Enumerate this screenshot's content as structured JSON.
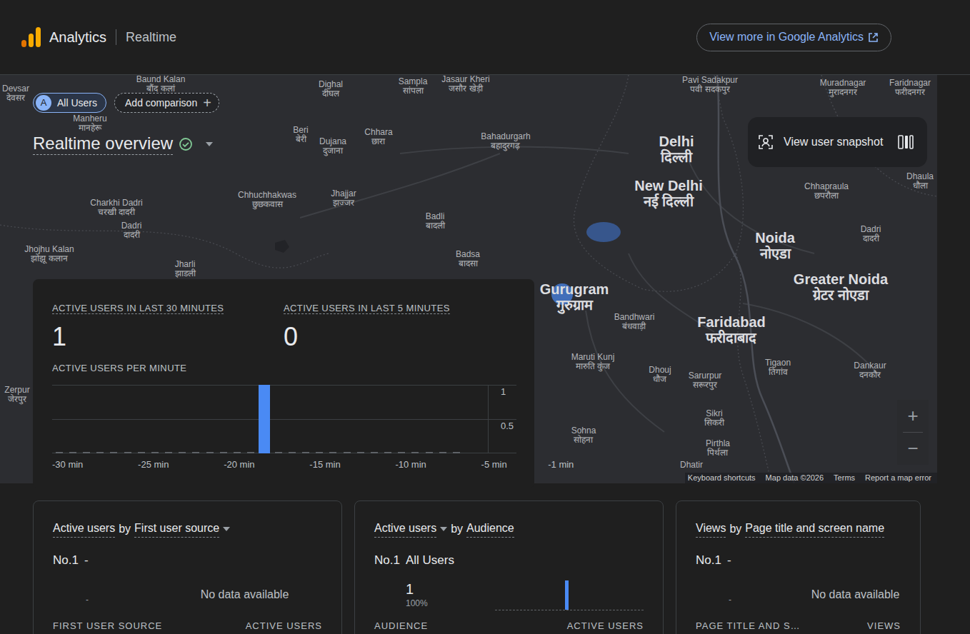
{
  "header": {
    "product": "Analytics",
    "page": "Realtime",
    "link_button": "View more in Google Analytics"
  },
  "comparisons": {
    "chips": [
      {
        "avatar": "A",
        "label": "All Users",
        "selected": true
      }
    ],
    "add": {
      "label": "Add comparison",
      "icon": "+"
    }
  },
  "report": {
    "title": "Realtime overview",
    "verified": true
  },
  "snapshot": {
    "label": "View user snapshot"
  },
  "map": {
    "places": [
      {
        "name": "Devsar",
        "local": "देवसर",
        "kind": "town",
        "has_users": false
      },
      {
        "name": "Baund Kalan",
        "local": "बौंद कलां",
        "kind": "town",
        "has_users": false
      },
      {
        "name": "Dighal",
        "local": "दीघल",
        "kind": "town",
        "has_users": false
      },
      {
        "name": "Sampla",
        "local": "सांपला",
        "kind": "town",
        "has_users": false
      },
      {
        "name": "Jasaur Kheri",
        "local": "जसौर खेड़ी",
        "kind": "town",
        "has_users": false
      },
      {
        "name": "Pavi Sadakpur",
        "local": "पवी सदकपुर",
        "kind": "town",
        "has_users": false
      },
      {
        "name": "Muradnagar",
        "local": "मुरादनगर",
        "kind": "town",
        "has_users": false
      },
      {
        "name": "Faridnagar",
        "local": "फरीदनगर",
        "kind": "town",
        "has_users": false
      },
      {
        "name": "Manheru",
        "local": "मानहेरू",
        "kind": "town",
        "has_users": false
      },
      {
        "name": "Beri",
        "local": "बेरी",
        "kind": "town",
        "has_users": false
      },
      {
        "name": "Dujana",
        "local": "दुजाना",
        "kind": "town",
        "has_users": false
      },
      {
        "name": "Chhara",
        "local": "छारा",
        "kind": "town",
        "has_users": false
      },
      {
        "name": "Bahadurgarh",
        "local": "बहादुरगढ़",
        "kind": "town",
        "has_users": false
      },
      {
        "name": "Delhi",
        "local": "दिल्ली",
        "kind": "city",
        "has_users": false
      },
      {
        "name": "New Delhi",
        "local": "नई दिल्ली",
        "kind": "city",
        "has_users": false
      },
      {
        "name": "Chhuchhakwas",
        "local": "छुछकवास",
        "kind": "town",
        "has_users": false
      },
      {
        "name": "Jhajjar",
        "local": "झज्जर",
        "kind": "town",
        "has_users": false
      },
      {
        "name": "Charkhi Dadri",
        "local": "चरखी दादरी",
        "kind": "town",
        "has_users": false
      },
      {
        "name": "Dadri",
        "local": "दादरी",
        "kind": "town",
        "has_users": false
      },
      {
        "name": "Chhapraula",
        "local": "छपरौला",
        "kind": "town",
        "has_users": false
      },
      {
        "name": "Dhaula",
        "local": "धौला",
        "kind": "town",
        "has_users": false
      },
      {
        "name": "Noida",
        "local": "नोएडा",
        "kind": "city",
        "has_users": false
      },
      {
        "name": "Dadri",
        "local": "दादरी",
        "kind": "town",
        "has_users": false
      },
      {
        "name": "Badli",
        "local": "बादली",
        "kind": "town",
        "has_users": false
      },
      {
        "name": "Jhojhu Kalan",
        "local": "झोझू कलान",
        "kind": "town",
        "has_users": false
      },
      {
        "name": "Badsa",
        "local": "बादसा",
        "kind": "town",
        "has_users": false
      },
      {
        "name": "Jharli",
        "local": "झाडली",
        "kind": "town",
        "has_users": false
      },
      {
        "name": "Greater Noida",
        "local": "ग्रेटर नोएडा",
        "kind": "city",
        "has_users": false
      },
      {
        "name": "Gurugram",
        "local": "गुरुग्राम",
        "kind": "city",
        "has_users": true
      },
      {
        "name": "Bandhwari",
        "local": "बंधवाड़ी",
        "kind": "town",
        "has_users": false
      },
      {
        "name": "Faridabad",
        "local": "फरीदाबाद",
        "kind": "city",
        "has_users": false
      },
      {
        "name": "Maruti Kunj",
        "local": "मारुति कुंज",
        "kind": "town",
        "has_users": false
      },
      {
        "name": "Dhouj",
        "local": "धौज",
        "kind": "town",
        "has_users": false
      },
      {
        "name": "Sarurpur",
        "local": "सरूरपुर",
        "kind": "town",
        "has_users": false
      },
      {
        "name": "Tigaon",
        "local": "तिगांव",
        "kind": "town",
        "has_users": false
      },
      {
        "name": "Dankaur",
        "local": "दनकौर",
        "kind": "town",
        "has_users": false
      },
      {
        "name": "Sikri",
        "local": "सिकरी",
        "kind": "town",
        "has_users": false
      },
      {
        "name": "Sohna",
        "local": "सोहना",
        "kind": "town",
        "has_users": false
      },
      {
        "name": "Pirthla",
        "local": "पिर्थला",
        "kind": "town",
        "has_users": false
      },
      {
        "name": "Zerpur",
        "local": "जेरपुर",
        "kind": "town",
        "has_users": false
      },
      {
        "name": "Dhatir",
        "kind": "town",
        "has_users": false
      }
    ],
    "zoom": [
      "+",
      "−"
    ],
    "attribution": [
      "Keyboard shortcuts",
      "Map data ©2026",
      "Terms",
      "Report a map error"
    ]
  },
  "summary": {
    "metrics": [
      {
        "label": "ACTIVE USERS IN LAST 30 MINUTES",
        "value": "1"
      },
      {
        "label": "ACTIVE USERS IN LAST 5 MINUTES",
        "value": "0"
      }
    ],
    "chart": {
      "title": "ACTIVE USERS PER MINUTE",
      "values": [
        0,
        0,
        0,
        0,
        0,
        0,
        0,
        0,
        0,
        0,
        0,
        0,
        0,
        0,
        0,
        1,
        0,
        0,
        0,
        0,
        0,
        0,
        0,
        0,
        0,
        0,
        0,
        0,
        0,
        0
      ],
      "y_ticks": [
        "1",
        "0.5"
      ],
      "x_ticks": [
        "-30 min",
        "-25 min",
        "-20 min",
        "-15 min",
        "-10 min",
        "-5 min",
        "-1 min"
      ]
    }
  },
  "cards": [
    {
      "kind": "empty",
      "title": [
        {
          "text": "Active users",
          "underlined": true,
          "dropdown": false
        },
        {
          "text": "by",
          "underlined": false,
          "dropdown": false
        },
        {
          "text": "First user source",
          "underlined": true,
          "dropdown": true
        }
      ],
      "rank": "No.1",
      "top_item": "-",
      "value": "-",
      "empty_text": "No data available",
      "columns": [
        "FIRST USER SOURCE",
        "ACTIVE USERS"
      ]
    },
    {
      "kind": "spark",
      "title": [
        {
          "text": "Active users",
          "underlined": true,
          "dropdown": true
        },
        {
          "text": "by",
          "underlined": false,
          "dropdown": false
        },
        {
          "text": "Audience",
          "underlined": true,
          "dropdown": false
        }
      ],
      "rank": "No.1",
      "top_item": "All Users",
      "value": "1",
      "share": "100%",
      "spark": [
        0,
        0,
        0,
        0,
        0,
        0,
        0,
        0,
        0,
        0,
        0,
        0,
        0,
        0,
        1,
        0,
        0,
        0,
        0,
        0,
        0,
        0,
        0,
        0,
        0,
        0,
        0,
        0,
        0,
        0
      ],
      "columns": [
        "AUDIENCE",
        "ACTIVE USERS"
      ]
    },
    {
      "kind": "empty",
      "title": [
        {
          "text": "Views",
          "underlined": true,
          "dropdown": false
        },
        {
          "text": "by",
          "underlined": false,
          "dropdown": false
        },
        {
          "text": "Page title and screen name",
          "underlined": true,
          "dropdown": false
        }
      ],
      "rank": "No.1",
      "top_item": "-",
      "value": "-",
      "empty_text": "No data available",
      "columns": [
        "PAGE TITLE AND S…",
        "VIEWS"
      ]
    }
  ]
}
